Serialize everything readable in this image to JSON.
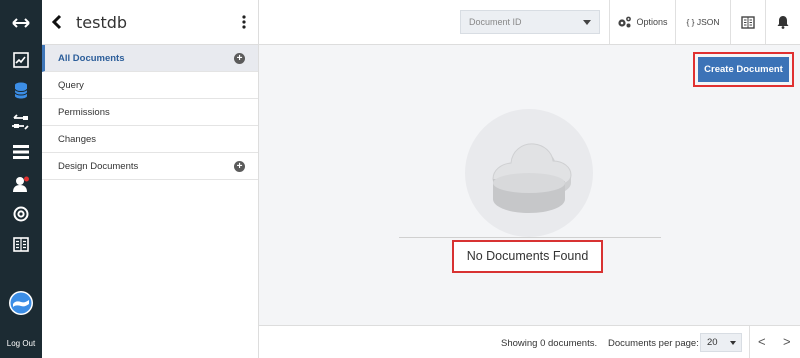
{
  "rail": {
    "items": [
      {
        "icon": "expand-arrows-icon"
      },
      {
        "icon": "activity-chart-icon"
      },
      {
        "icon": "database-icon",
        "active": true
      },
      {
        "icon": "replication-icon"
      },
      {
        "icon": "setup-icon"
      },
      {
        "icon": "user-icon"
      },
      {
        "icon": "support-icon"
      },
      {
        "icon": "documentation-icon"
      },
      {
        "icon": "couchdb-logo-icon"
      }
    ],
    "logout_label": "Log Out"
  },
  "database": {
    "name": "testdb"
  },
  "sidebar": {
    "items": [
      {
        "label": "All Documents",
        "active": true,
        "has_add": true
      },
      {
        "label": "Query"
      },
      {
        "label": "Permissions"
      },
      {
        "label": "Changes"
      },
      {
        "label": "Design Documents",
        "has_add": true
      }
    ]
  },
  "toolbar": {
    "doc_id_placeholder": "Document ID",
    "options_label": "Options",
    "json_label": "{ } JSON"
  },
  "main": {
    "create_button": "Create Document",
    "empty_message": "No Documents Found"
  },
  "footer": {
    "showing": "Showing 0 documents.",
    "per_page_label": "Documents per page:",
    "per_page_value": "20",
    "prev": "<",
    "next": ">"
  },
  "colors": {
    "rail_bg": "#1c2b33",
    "accent": "#3c73b7",
    "highlight_border": "#e03030"
  }
}
